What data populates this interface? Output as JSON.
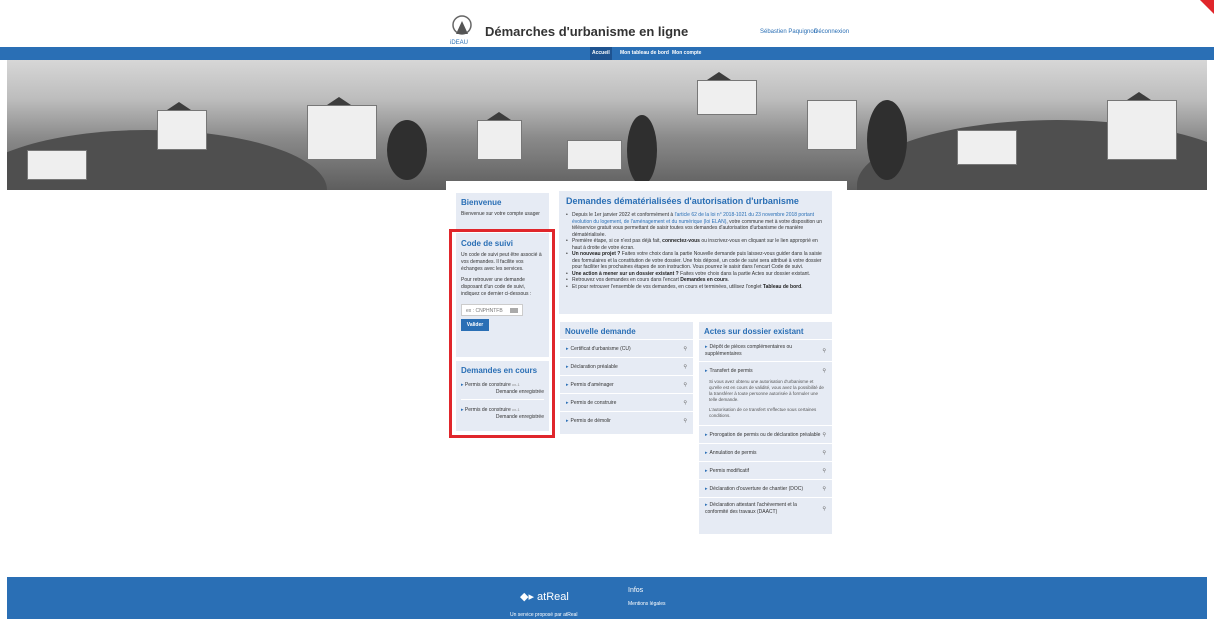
{
  "header": {
    "logo_text": "iDEAU",
    "title": "Démarches d'urbanisme en ligne",
    "user": "Sébastien Paquignon",
    "logout": "Déconnexion"
  },
  "nav": {
    "items": [
      "Accueil",
      "Mon tableau de bord",
      "Mon compte"
    ],
    "active": "Accueil"
  },
  "welcome": {
    "title": "Bienvenue",
    "text": "Bienvenue sur votre compte usager"
  },
  "suivi": {
    "title": "Code de suivi",
    "text1": "Un code de suivi peut être associé à vos demandes. Il facilite vos échanges avec les services.",
    "text2": "Pour retrouver une demande disposant d'un code de suivi, indiquez ce dernier ci-dessous :",
    "input_value": "CNPHNTFB",
    "input_prefix": "ex :",
    "button": "Valider"
  },
  "encours": {
    "title": "Demandes en cours",
    "items": [
      {
        "label": "Permis de construire",
        "tag": "cx-1",
        "status": "Demande enregistrée"
      },
      {
        "label": "Permis de construire",
        "tag": "cx-1",
        "status": "Demande enregistrée"
      }
    ]
  },
  "demandes": {
    "title": "Demandes dématérialisées d'autorisation d'urbanisme",
    "bullets": [
      {
        "pre": "Depuis le 1er janvier 2022 et conformément à ",
        "link": "l'article 62 de la loi n° 2018-1021 du 23 novembre 2018 portant évolution du logement, de l'aménagement et du numérique (loi ELAN)",
        "post": ", votre commune met à votre disposition un téléservice gratuit vous permettant de saisir toutes vos demandes d'autorisation d'urbanisme de manière dématérialisée."
      },
      {
        "pre": "Première étape, si ce n'est pas déjà fait, ",
        "bold": "connectez-vous",
        "post": " ou inscrivez-vous en cliquant sur le lien approprié en haut à droite de votre écran."
      },
      {
        "bold": "Un nouveau projet ?",
        "post": " Faites votre choix dans la partie Nouvelle demande puis laissez-vous guider dans la saisie des formulaires et la constitution de votre dossier. Une fois déposé, un code de suivi sera attribué à votre dossier pour faciliter les prochaines étapes de son instruction. Vous pourrez le saisir dans l'encart Code de suivi."
      },
      {
        "bold": "Une action à mener sur un dossier existant ?",
        "post": " Faites votre choix dans la partie Actes sur dossier existant."
      },
      {
        "pre": "Retrouvez vos demandes en cours dans l'encart ",
        "bold": "Demandes en cours",
        "post": "."
      },
      {
        "pre": "Et pour retrouver l'ensemble de vos demandes, en cours et terminées, utilisez l'onglet ",
        "bold": "Tableau de bord",
        "post": "."
      }
    ]
  },
  "nouvelle": {
    "title": "Nouvelle demande",
    "items": [
      "Certificat d'urbanisme (CU)",
      "Déclaration préalable",
      "Permis d'aménager",
      "Permis de construire",
      "Permis de démolir"
    ]
  },
  "actes": {
    "title": "Actes sur dossier existant",
    "items": [
      {
        "label": "Dépôt de pièces complémentaires ou supplémentaires"
      },
      {
        "label": "Transfert de permis",
        "desc": "Si vous avez obtenu une autorisation d'urbanisme et qu'elle est en cours de validité, vous avez la possibilité de la transférer à toute personne autorisée à formuler une telle demande.",
        "desc2": "L'autorisation de ce transfert s'effectue sous certaines conditions."
      },
      {
        "label": "Prorogation de permis ou de déclaration préalable"
      },
      {
        "label": "Annulation de permis"
      },
      {
        "label": "Permis modificatif"
      },
      {
        "label": "Déclaration d'ouverture de chantier (DOC)"
      },
      {
        "label": "Déclaration attestant l'achèvement et la conformité des travaux (DAACT)"
      }
    ]
  },
  "footer": {
    "logo": "atReal",
    "service": "Un service proposé par atReal",
    "infos": "Infos",
    "mentions": "Mentions légales"
  },
  "colors": {
    "primary": "#2a6fb5",
    "card": "#e6ebf4",
    "highlight": "#e0262b"
  },
  "icons": [
    "user-location-icon",
    "triangle-right-icon",
    "zoom-icon",
    "keyboard-icon"
  ]
}
